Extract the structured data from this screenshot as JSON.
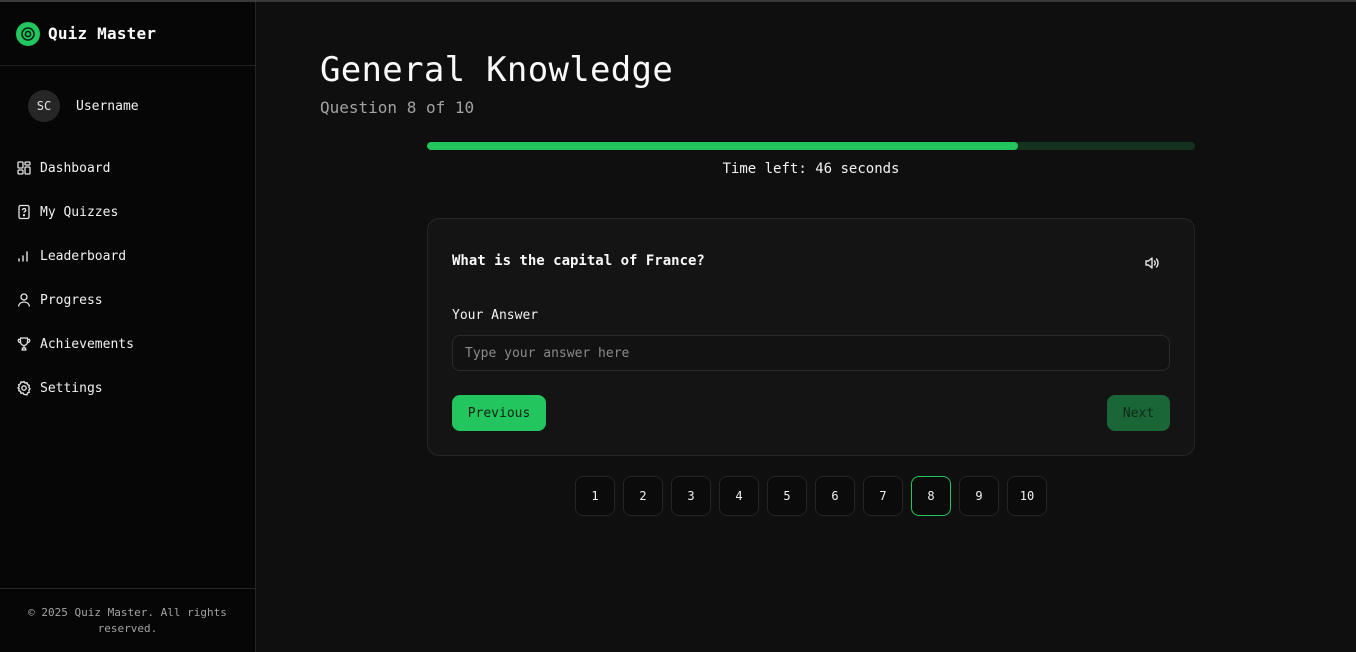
{
  "brand": {
    "title": "Quiz Master",
    "accent": "#22c55e",
    "icon": "quiz-logo-icon"
  },
  "user": {
    "initials": "SC",
    "name": "Username"
  },
  "sidebar": {
    "items": [
      {
        "label": "Dashboard",
        "icon": "dashboard-icon"
      },
      {
        "label": "My Quizzes",
        "icon": "quiz-file-icon"
      },
      {
        "label": "Leaderboard",
        "icon": "bar-chart-icon"
      },
      {
        "label": "Progress",
        "icon": "user-icon"
      },
      {
        "label": "Achievements",
        "icon": "trophy-icon"
      },
      {
        "label": "Settings",
        "icon": "gear-icon"
      }
    ],
    "footer": "© 2025 Quiz Master. All rights reserved."
  },
  "main": {
    "title": "General Knowledge",
    "subtitle": "Question 8 of 10",
    "progress_fraction": 0.77,
    "timer_text": "Time left: 46 seconds",
    "question": "What is the capital of France?",
    "speaker_icon": "speaker-icon",
    "answer_label": "Your Answer",
    "answer_placeholder": "Type your answer here",
    "answer_value": "",
    "previous_label": "Previous",
    "next_label": "Next",
    "pages": [
      "1",
      "2",
      "3",
      "4",
      "5",
      "6",
      "7",
      "8",
      "9",
      "10"
    ],
    "current_page": "8"
  },
  "colors": {
    "background": "#0f0f0f",
    "sidebar": "#060606",
    "accent": "#22c55e",
    "accent_dark": "#1a6636"
  }
}
